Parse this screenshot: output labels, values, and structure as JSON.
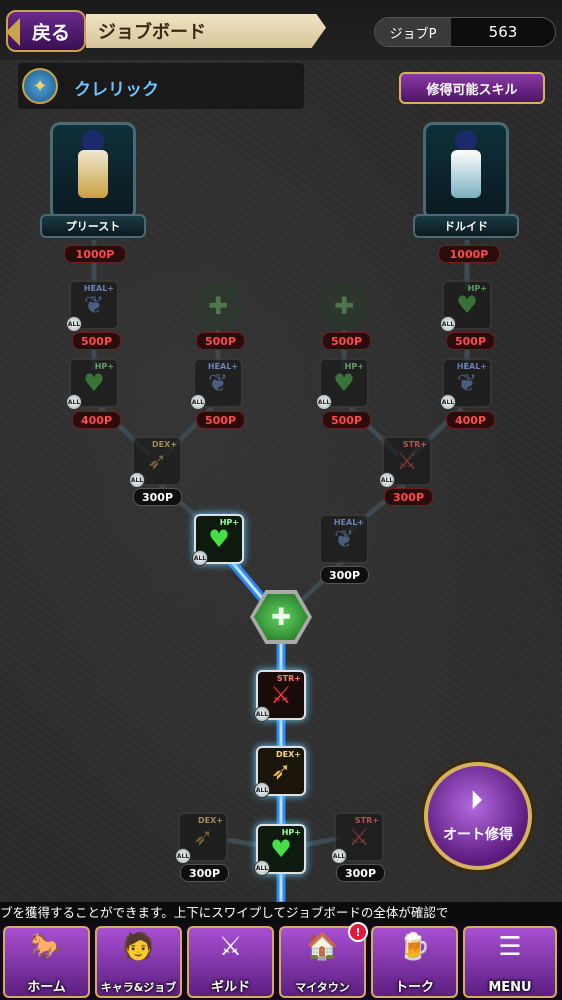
{
  "header": {
    "back_label": "戻る",
    "title": "ジョブボード",
    "job_points_label": "ジョブP",
    "job_points_value": "563"
  },
  "current_class": {
    "name": "クレリック"
  },
  "learnable_skills_button": "修得可能スキル",
  "advanced_jobs": [
    {
      "name": "プリースト",
      "cost": "1000P"
    },
    {
      "name": "ドルイド",
      "cost": "1000P"
    }
  ],
  "nodes": [
    {
      "id": "n1",
      "label": "HEAL+",
      "cost": "500P",
      "all": true,
      "state": "locked"
    },
    {
      "id": "n2",
      "label": "",
      "cost": "500P",
      "all": false,
      "state": "locked"
    },
    {
      "id": "n3",
      "label": "",
      "cost": "500P",
      "all": false,
      "state": "locked"
    },
    {
      "id": "n4",
      "label": "HP+",
      "cost": "500P",
      "all": true,
      "state": "locked"
    },
    {
      "id": "n5",
      "label": "HP+",
      "cost": "400P",
      "all": true,
      "state": "locked"
    },
    {
      "id": "n6",
      "label": "HEAL+",
      "cost": "500P",
      "all": true,
      "state": "locked"
    },
    {
      "id": "n7",
      "label": "HP+",
      "cost": "500P",
      "all": true,
      "state": "locked"
    },
    {
      "id": "n8",
      "label": "HEAL+",
      "cost": "400P",
      "all": true,
      "state": "locked"
    },
    {
      "id": "n9",
      "label": "DEX+",
      "cost": "300P",
      "all": true,
      "state": "available"
    },
    {
      "id": "n10",
      "label": "STR+",
      "cost": "300P",
      "all": true,
      "state": "locked"
    },
    {
      "id": "n11",
      "label": "HP+",
      "cost": "",
      "all": true,
      "state": "learned"
    },
    {
      "id": "n12",
      "label": "HEAL+",
      "cost": "300P",
      "all": false,
      "state": "available"
    },
    {
      "id": "n13",
      "label": "",
      "cost": "",
      "all": false,
      "state": "learned"
    },
    {
      "id": "n14",
      "label": "STR+",
      "cost": "",
      "all": true,
      "state": "learned"
    },
    {
      "id": "n15",
      "label": "DEX+",
      "cost": "",
      "all": true,
      "state": "learned"
    },
    {
      "id": "n16",
      "label": "DEX+",
      "cost": "300P",
      "all": true,
      "state": "available"
    },
    {
      "id": "n17",
      "label": "HP+",
      "cost": "",
      "all": true,
      "state": "learned"
    },
    {
      "id": "n18",
      "label": "STR+",
      "cost": "300P",
      "all": true,
      "state": "available"
    }
  ],
  "auto_learn_button": "オート修得",
  "ticker": "ブを獲得することができます。上下にスワイプしてジョブボードの全体が確認で",
  "bottom_nav": [
    {
      "label": "ホーム",
      "icon": "home-icon"
    },
    {
      "label": "キャラ&ジョブ",
      "icon": "character-icon"
    },
    {
      "label": "ギルド",
      "icon": "guild-icon"
    },
    {
      "label": "マイタウン",
      "icon": "town-icon",
      "badge": "!"
    },
    {
      "label": "トーク",
      "icon": "talk-icon"
    },
    {
      "label": "MENU",
      "icon": "menu-icon"
    }
  ],
  "colors": {
    "accent_purple": "#8a3aa6",
    "gold_border": "#d6b25a",
    "active_path_blue": "#2e8dff",
    "cost_red": "#ff4a4a",
    "node_green": "#3fc83f"
  }
}
